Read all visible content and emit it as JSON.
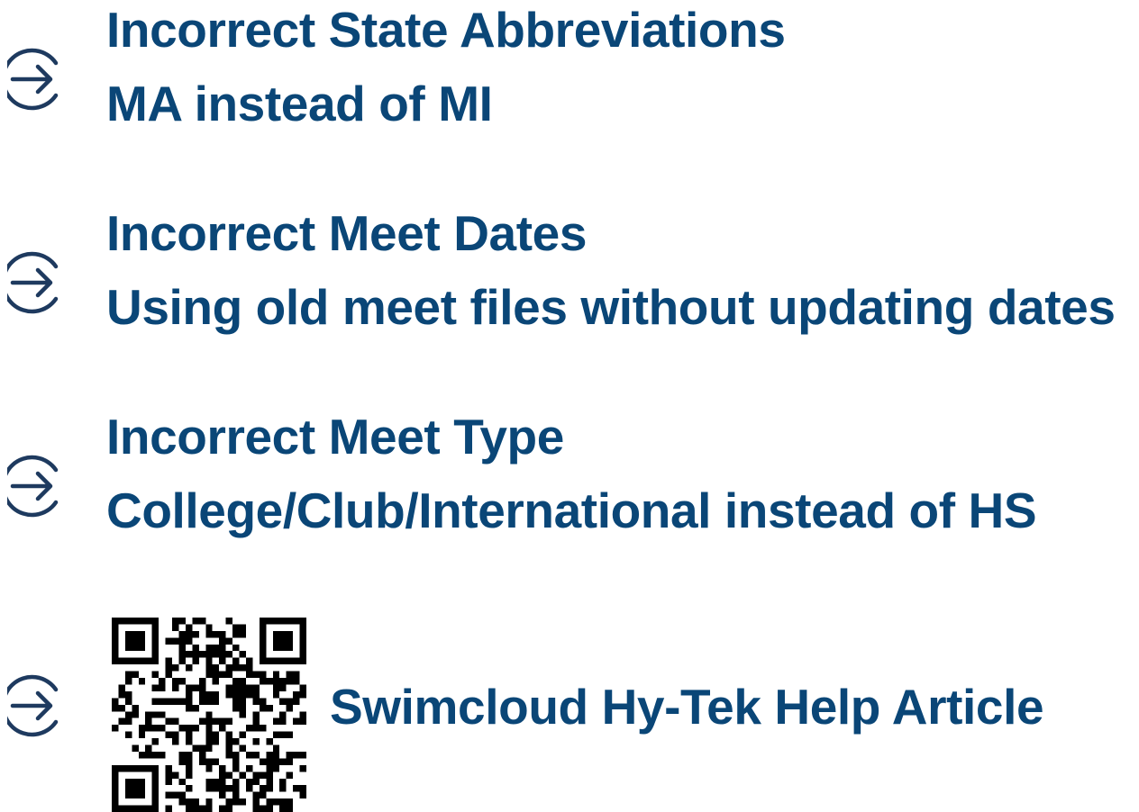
{
  "items": [
    {
      "title": "Incorrect State Abbreviations",
      "detail": "MA instead of MI"
    },
    {
      "title": "Incorrect Meet Dates",
      "detail": "Using old meet files without updating dates"
    },
    {
      "title": "Incorrect Meet Type",
      "detail": "College/Club/International instead of HS"
    }
  ],
  "link": {
    "label": "Swimcloud Hy-Tek Help Article"
  },
  "colors": {
    "text": "#0a4677",
    "icon": "#1e3a5f"
  },
  "icons": {
    "bullet": "arrow-circle-icon",
    "qr": "qr-code-icon"
  }
}
